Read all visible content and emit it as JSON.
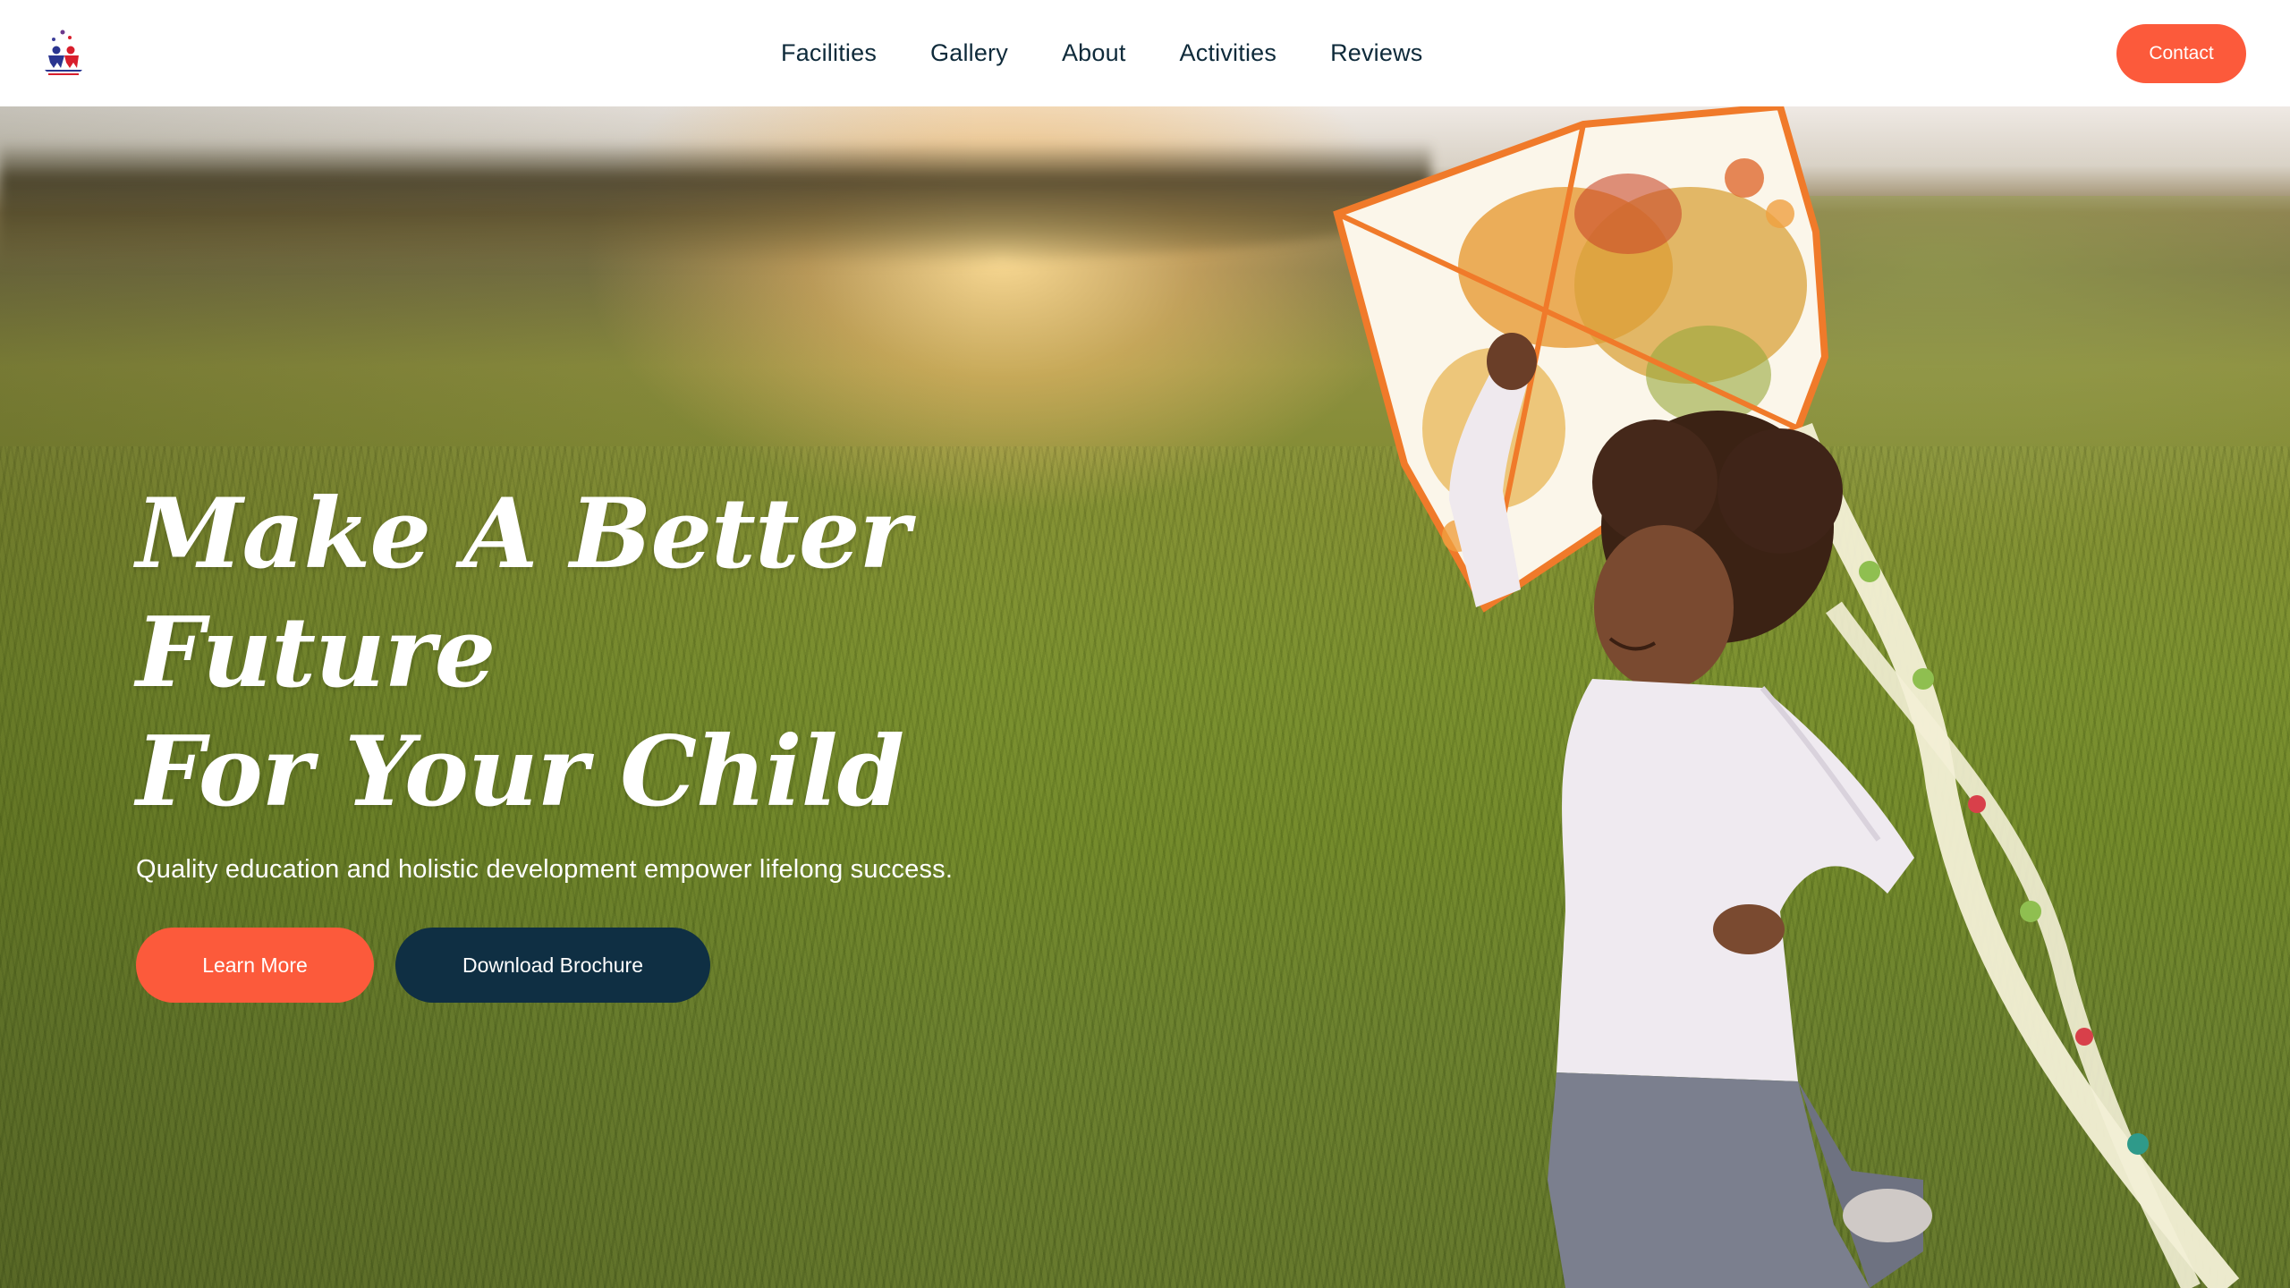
{
  "nav": {
    "links": [
      "Facilities",
      "Gallery",
      "About",
      "Activities",
      "Reviews"
    ],
    "contact_label": "Contact"
  },
  "hero": {
    "title_line1": "Make A Better Future",
    "title_line2": "For Your Child",
    "subtitle": "Quality education and holistic development empower lifelong success.",
    "primary_button": "Learn More",
    "secondary_button": "Download Brochure"
  },
  "colors": {
    "accent": "#fc5a3b",
    "dark": "#0f2f43",
    "nav_text": "#0e2a3a"
  }
}
